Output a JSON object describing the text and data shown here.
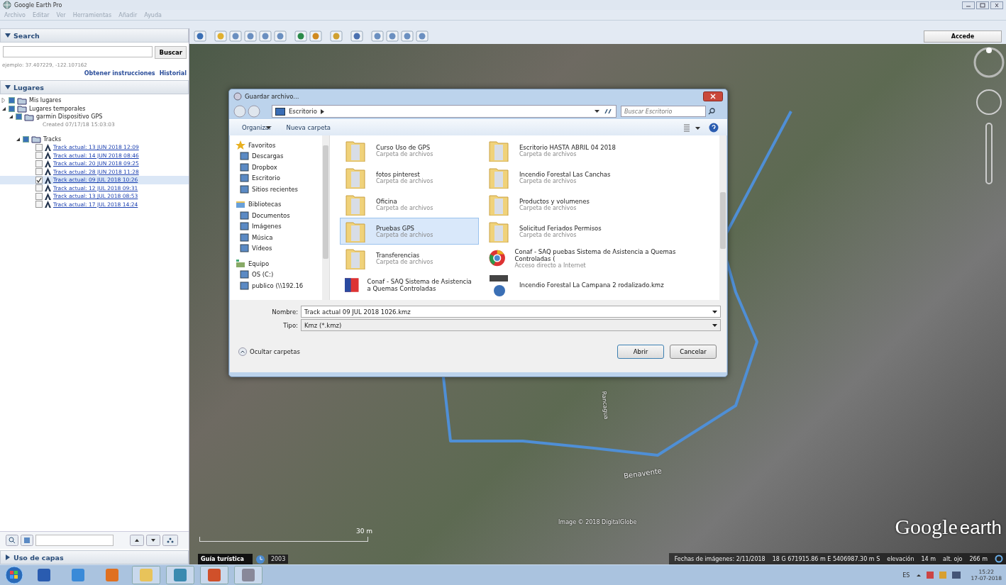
{
  "window": {
    "title": "Google Earth Pro"
  },
  "menu": [
    "Archivo",
    "Editar",
    "Ver",
    "Herramientas",
    "Añadir",
    "Ayuda"
  ],
  "search_panel": {
    "header": "Search",
    "button": "Buscar",
    "hint": "ejemplo: 37.407229, -122.107162",
    "links": [
      "Obtener instrucciones",
      "Historial"
    ]
  },
  "places_panel": {
    "header": "Lugares",
    "tree": [
      {
        "kind": "folder",
        "label": "Mis lugares",
        "expanded": false
      },
      {
        "kind": "folder",
        "label": "Lugares temporales",
        "expanded": true,
        "children": [
          {
            "kind": "folder",
            "label": "garmin Dispositivo GPS",
            "expanded": true,
            "note": "Created 07/17/18 15:03:03",
            "children": [
              {
                "kind": "folder",
                "label": "Tracks",
                "expanded": true,
                "children": [
                  {
                    "kind": "track",
                    "label": "Track actual: 13 JUN 2018 12:09",
                    "checked": false,
                    "selected": false
                  },
                  {
                    "kind": "track",
                    "label": "Track actual: 14 JUN 2018 08:46",
                    "checked": false,
                    "selected": false
                  },
                  {
                    "kind": "track",
                    "label": "Track actual: 20 JUN 2018 09:25",
                    "checked": false,
                    "selected": false
                  },
                  {
                    "kind": "track",
                    "label": "Track actual: 28 JUN 2018 11:28",
                    "checked": false,
                    "selected": false
                  },
                  {
                    "kind": "track",
                    "label": "Track actual: 09 JUL 2018 10:26",
                    "checked": true,
                    "selected": true
                  },
                  {
                    "kind": "track",
                    "label": "Track actual: 12 JUL 2018 09:31",
                    "checked": false,
                    "selected": false
                  },
                  {
                    "kind": "track",
                    "label": "Track actual: 13 JUL 2018 08:53",
                    "checked": false,
                    "selected": false
                  },
                  {
                    "kind": "track",
                    "label": "Track actual: 17 JUL 2018 14:24",
                    "checked": false,
                    "selected": false
                  }
                ]
              }
            ]
          }
        ]
      }
    ]
  },
  "layers_panel": {
    "header": "Uso de capas"
  },
  "toolbar": {
    "button": "Accede"
  },
  "map": {
    "streets": [
      "Benavente",
      "Rancagua"
    ],
    "attribution": "Image © 2018 DigitalGlobe",
    "scale": "30 m",
    "tour_label": "Guía turística",
    "year": "2003",
    "logo": [
      "Google",
      "earth"
    ],
    "status": {
      "date": "Fechas de imágenes: 2/11/2018",
      "coords": "18 G 671915.86 m E 5406987.30 m S",
      "elevation_label": "elevación",
      "elevation": "14 m",
      "eye_label": "alt. ojo",
      "eye": "266 m"
    }
  },
  "dialog": {
    "title": "Guardar archivo...",
    "path": "Escritorio",
    "search_placeholder": "Buscar Escritorio",
    "commands": [
      "Organizar",
      "Nueva carpeta"
    ],
    "nav": [
      {
        "label": "Favoritos",
        "items": [
          "Descargas",
          "Dropbox",
          "Escritorio",
          "Sitios recientes"
        ]
      },
      {
        "label": "Bibliotecas",
        "items": [
          "Documentos",
          "Imágenes",
          "Música",
          "Vídeos"
        ]
      },
      {
        "label": "Equipo",
        "items": [
          "OS (C:)",
          "publico (\\\\192.16"
        ]
      }
    ],
    "files": [
      {
        "kind": "folder",
        "name": "Curso Uso de GPS",
        "detail": "Carpeta de archivos",
        "selected": false
      },
      {
        "kind": "folder",
        "name": "Escritorio HASTA ABRIL 04 2018",
        "detail": "Carpeta de archivos",
        "selected": false
      },
      {
        "kind": "folder",
        "name": "fotos pinterest",
        "detail": "Carpeta de archivos",
        "selected": false
      },
      {
        "kind": "folder",
        "name": "Incendio Forestal Las Canchas",
        "detail": "Carpeta de archivos",
        "selected": false
      },
      {
        "kind": "folder",
        "name": "Oficina",
        "detail": "Carpeta de archivos",
        "selected": false
      },
      {
        "kind": "folder",
        "name": "Productos y volumenes",
        "detail": "Carpeta de archivos",
        "selected": false
      },
      {
        "kind": "folder",
        "name": "Pruebas GPS",
        "detail": "Carpeta de archivos",
        "selected": true
      },
      {
        "kind": "folder",
        "name": "Solicitud Feriados Permisos",
        "detail": "Carpeta de archivos",
        "selected": false
      },
      {
        "kind": "folder",
        "name": "Transferencias",
        "detail": "Carpeta de archivos",
        "selected": false
      },
      {
        "kind": "shortcut",
        "name": "Conaf - SAQ  puebas Sistema de Asistencia a Quemas Controladas (",
        "detail": "Acceso directo a Internet",
        "selected": false
      },
      {
        "kind": "app",
        "name": "Conaf - SAQ  Sistema de Asistencia a Quemas Controladas",
        "selected": false
      },
      {
        "kind": "kmz",
        "name": "Incendio Forestal La Campana 2 rodalizado.kmz",
        "selected": false
      }
    ],
    "name_label": "Nombre:",
    "name_value": "Track actual 09 JUL 2018 1026.kmz",
    "type_label": "Tipo:",
    "type_value": "Kmz (*.kmz)",
    "hide_folders": "Ocultar carpetas",
    "buttons": [
      "Abrir",
      "Cancelar"
    ]
  },
  "taskbar": {
    "language": "ES",
    "time": "15:22",
    "date": "17-07-2018"
  }
}
